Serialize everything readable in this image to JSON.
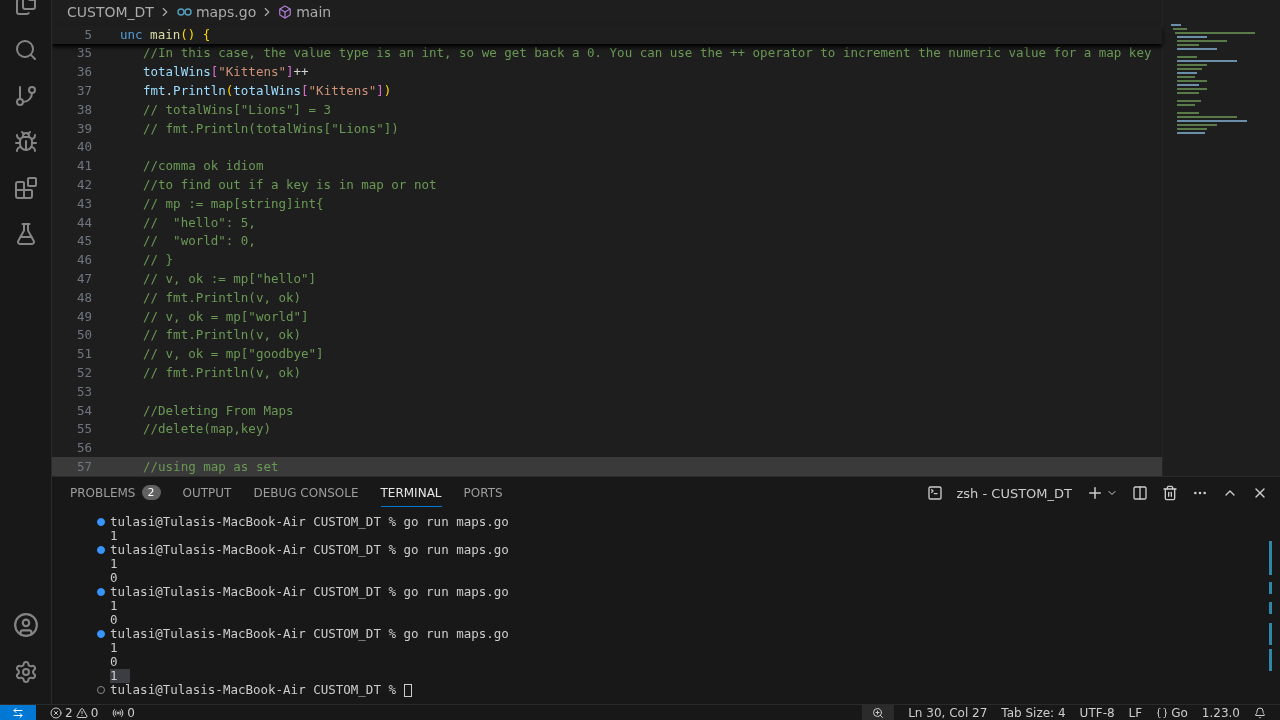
{
  "breadcrumb": [
    "CUSTOM_DT",
    "maps.go",
    "main"
  ],
  "sticky_line": {
    "number": "5",
    "tokens": [
      {
        "text": "unc ",
        "kind": "keyword"
      },
      {
        "text": "main",
        "kind": "func"
      },
      {
        "text": "() {",
        "kind": "bracket"
      }
    ]
  },
  "code_lines": [
    {
      "number": "35",
      "highlighted": false,
      "tokens": [
        {
          "text": "//In this case, the value type is an int, so we get back a 0. You can use the ++ operator to increment the numeric value for a map key",
          "kind": "comment"
        }
      ]
    },
    {
      "number": "36",
      "highlighted": false,
      "tokens": [
        {
          "text": "totalWins",
          "kind": "ident"
        },
        {
          "text": "[",
          "kind": "bracket2"
        },
        {
          "text": "\"Kittens\"",
          "kind": "string"
        },
        {
          "text": "]",
          "kind": "bracket2"
        },
        {
          "text": "++",
          "kind": "plain"
        }
      ]
    },
    {
      "number": "37",
      "highlighted": false,
      "tokens": [
        {
          "text": "fmt",
          "kind": "ident"
        },
        {
          "text": ".",
          "kind": "plain"
        },
        {
          "text": "Println",
          "kind": "ident"
        },
        {
          "text": "(",
          "kind": "bracket"
        },
        {
          "text": "totalWins",
          "kind": "ident"
        },
        {
          "text": "[",
          "kind": "bracket2"
        },
        {
          "text": "\"Kittens\"",
          "kind": "string"
        },
        {
          "text": "]",
          "kind": "bracket2"
        },
        {
          "text": ")",
          "kind": "bracket"
        }
      ]
    },
    {
      "number": "38",
      "highlighted": false,
      "tokens": [
        {
          "text": "// totalWins[\"Lions\"] = 3",
          "kind": "comment"
        }
      ]
    },
    {
      "number": "39",
      "highlighted": false,
      "tokens": [
        {
          "text": "// fmt.Println(totalWins[\"Lions\"])",
          "kind": "comment"
        }
      ]
    },
    {
      "number": "40",
      "highlighted": false
    },
    {
      "number": "41",
      "highlighted": false,
      "tokens": [
        {
          "text": "//comma ok idiom",
          "kind": "comment"
        }
      ]
    },
    {
      "number": "42",
      "highlighted": false,
      "tokens": [
        {
          "text": "//to find out if a key is in map or not",
          "kind": "comment"
        }
      ]
    },
    {
      "number": "43",
      "highlighted": false,
      "tokens": [
        {
          "text": "// mp := map[string]int{",
          "kind": "comment"
        }
      ]
    },
    {
      "number": "44",
      "highlighted": false,
      "tokens": [
        {
          "text": "//  \"hello\": 5,",
          "kind": "comment"
        }
      ]
    },
    {
      "number": "45",
      "highlighted": false,
      "tokens": [
        {
          "text": "//  \"world\": 0,",
          "kind": "comment"
        }
      ]
    },
    {
      "number": "46",
      "highlighted": false,
      "tokens": [
        {
          "text": "// }",
          "kind": "comment"
        }
      ]
    },
    {
      "number": "47",
      "highlighted": false,
      "tokens": [
        {
          "text": "// v, ok := mp[\"hello\"]",
          "kind": "comment"
        }
      ]
    },
    {
      "number": "48",
      "highlighted": false,
      "tokens": [
        {
          "text": "// fmt.Println(v, ok)",
          "kind": "comment"
        }
      ]
    },
    {
      "number": "49",
      "highlighted": false,
      "tokens": [
        {
          "text": "// v, ok = mp[\"world\"]",
          "kind": "comment"
        }
      ]
    },
    {
      "number": "50",
      "highlighted": false,
      "tokens": [
        {
          "text": "// fmt.Println(v, ok)",
          "kind": "comment"
        }
      ]
    },
    {
      "number": "51",
      "highlighted": false,
      "tokens": [
        {
          "text": "// v, ok = mp[\"goodbye\"]",
          "kind": "comment"
        }
      ]
    },
    {
      "number": "52",
      "highlighted": false,
      "tokens": [
        {
          "text": "// fmt.Println(v, ok)",
          "kind": "comment"
        }
      ]
    },
    {
      "number": "53",
      "highlighted": false
    },
    {
      "number": "54",
      "highlighted": false,
      "tokens": [
        {
          "text": "//Deleting From Maps",
          "kind": "comment"
        }
      ]
    },
    {
      "number": "55",
      "highlighted": false,
      "tokens": [
        {
          "text": "//delete(map,key)",
          "kind": "comment"
        }
      ]
    },
    {
      "number": "56",
      "highlighted": false
    },
    {
      "number": "57",
      "highlighted": true,
      "tokens": [
        {
          "text": "//using map as set",
          "kind": "comment"
        }
      ]
    }
  ],
  "panel_tabs": [
    {
      "label": "PROBLEMS",
      "badge": "2",
      "selected": false
    },
    {
      "label": "OUTPUT",
      "selected": false
    },
    {
      "label": "DEBUG CONSOLE",
      "selected": false
    },
    {
      "label": "TERMINAL",
      "selected": true
    },
    {
      "label": "PORTS",
      "selected": false
    }
  ],
  "terminal_name": "zsh - CUSTOM_DT",
  "terminal_lines": [
    {
      "kind": "prompt",
      "finished": true,
      "prompt": "tulasi@Tulasis-MacBook-Air CUSTOM_DT % ",
      "command": "go run maps.go"
    },
    {
      "kind": "output",
      "text": "1",
      "highlighted": false
    },
    {
      "kind": "prompt",
      "finished": true,
      "prompt": "tulasi@Tulasis-MacBook-Air CUSTOM_DT % ",
      "command": "go run maps.go"
    },
    {
      "kind": "output",
      "text": "1",
      "highlighted": false
    },
    {
      "kind": "output",
      "text": "0",
      "highlighted": false
    },
    {
      "kind": "prompt",
      "finished": true,
      "prompt": "tulasi@Tulasis-MacBook-Air CUSTOM_DT % ",
      "command": "go run maps.go"
    },
    {
      "kind": "output",
      "text": "1",
      "highlighted": false
    },
    {
      "kind": "output",
      "text": "0",
      "highlighted": false
    },
    {
      "kind": "prompt",
      "finished": true,
      "prompt": "tulasi@Tulasis-MacBook-Air CUSTOM_DT % ",
      "command": "go run maps.go"
    },
    {
      "kind": "output",
      "text": "1",
      "highlighted": false
    },
    {
      "kind": "output",
      "text": "0",
      "highlighted": false
    },
    {
      "kind": "output",
      "text": "1",
      "highlighted": true
    },
    {
      "kind": "prompt",
      "finished": false,
      "prompt": "tulasi@Tulasis-MacBook-Air CUSTOM_DT % "
    }
  ],
  "status_bar": {
    "errors": "2",
    "warnings": "0",
    "ports": "0",
    "position": "Ln 30, Col 27",
    "tab_size": "Tab Size: 4",
    "encoding": "UTF-8",
    "eol": "LF",
    "language": "Go",
    "version": "1.23.0"
  }
}
